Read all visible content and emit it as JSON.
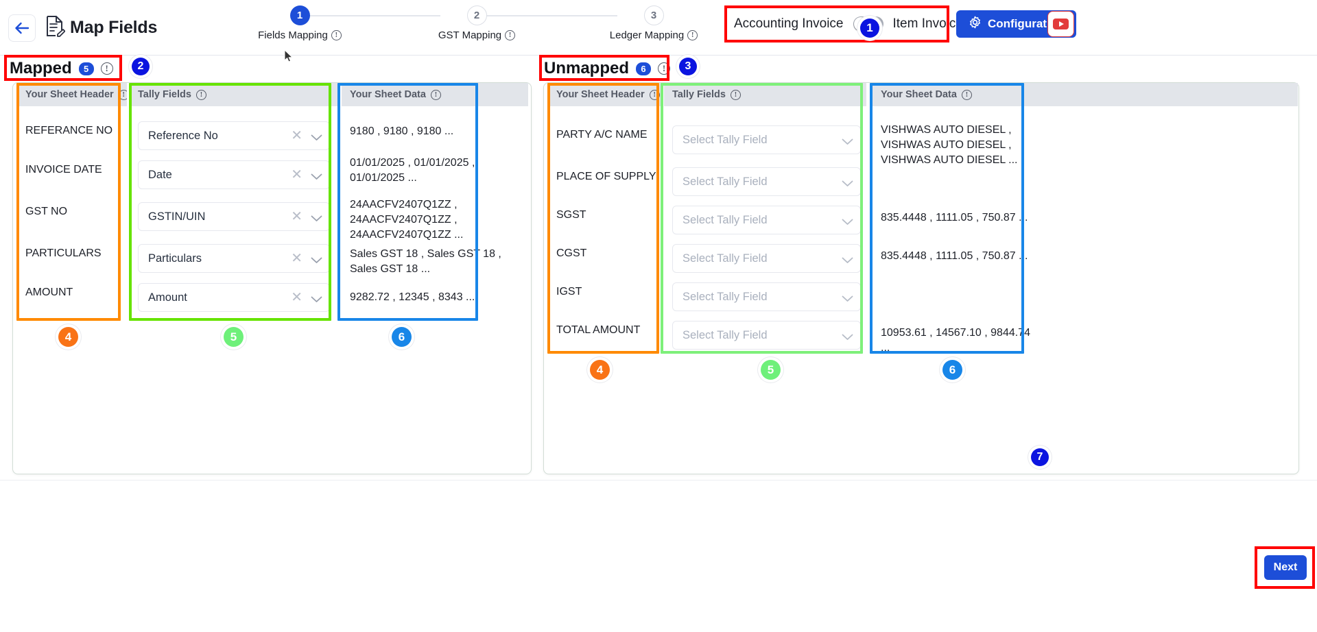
{
  "header": {
    "back_icon": "arrow-left-icon",
    "doc_icon": "document-edit-icon",
    "title": "Map Fields",
    "steps": [
      {
        "number": "1",
        "label": "Fields Mapping",
        "state": "active"
      },
      {
        "number": "2",
        "label": "GST Mapping",
        "state": "idle"
      },
      {
        "number": "3",
        "label": "Ledger Mapping",
        "state": "idle"
      }
    ],
    "toggle": {
      "left_label": "Accounting Invoice",
      "right_label": "Item Invoice",
      "state": "left"
    },
    "configuration_button": "Configuration",
    "gear_icon": "gear-icon",
    "youtube_icon": "youtube-icon",
    "marker_1": "1"
  },
  "mapped": {
    "title": "Mapped",
    "count": "5",
    "marker": "2",
    "columns": {
      "sheet_header": {
        "label": "Your Sheet Header",
        "marker": "4"
      },
      "tally_fields": {
        "label": "Tally Fields",
        "marker": "5"
      },
      "sheet_data": {
        "label": "Your Sheet Data",
        "marker": "6"
      }
    },
    "rows": [
      {
        "sheet_header": "REFERANCE NO",
        "tally_field": "Reference No",
        "sheet_data": "9180 , 9180 , 9180 ..."
      },
      {
        "sheet_header": "INVOICE DATE",
        "tally_field": "Date",
        "sheet_data": "01/01/2025 , 01/01/2025 , 01/01/2025 ..."
      },
      {
        "sheet_header": "GST NO",
        "tally_field": "GSTIN/UIN",
        "sheet_data": "24AACFV2407Q1ZZ , 24AACFV2407Q1ZZ , 24AACFV2407Q1ZZ ..."
      },
      {
        "sheet_header": "PARTICULARS",
        "tally_field": "Particulars",
        "sheet_data": "Sales GST 18 , Sales GST 18 , Sales GST 18 ..."
      },
      {
        "sheet_header": "AMOUNT",
        "tally_field": "Amount",
        "sheet_data": "9282.72 , 12345 , 8343 ..."
      }
    ]
  },
  "unmapped": {
    "title": "Unmapped",
    "count": "6",
    "marker": "3",
    "panel_marker": "7",
    "columns": {
      "sheet_header": {
        "label": "Your Sheet Header",
        "marker": "4"
      },
      "tally_fields": {
        "label": "Tally Fields",
        "marker": "5"
      },
      "sheet_data": {
        "label": "Your Sheet Data",
        "marker": "6"
      }
    },
    "select_placeholder": "Select Tally Field",
    "rows": [
      {
        "sheet_header": "PARTY A/C NAME",
        "tally_field": "",
        "sheet_data": "VISHWAS AUTO DIESEL , VISHWAS AUTO DIESEL , VISHWAS AUTO DIESEL ..."
      },
      {
        "sheet_header": "PLACE OF SUPPLY",
        "tally_field": "",
        "sheet_data": ""
      },
      {
        "sheet_header": "SGST",
        "tally_field": "",
        "sheet_data": "835.4448 , 1111.05 , 750.87 ..."
      },
      {
        "sheet_header": "CGST",
        "tally_field": "",
        "sheet_data": "835.4448 , 1111.05 , 750.87 ..."
      },
      {
        "sheet_header": "IGST",
        "tally_field": "",
        "sheet_data": ""
      },
      {
        "sheet_header": "TOTAL AMOUNT",
        "tally_field": "",
        "sheet_data": "10953.61 , 14567.10 , 9844.74 ..."
      }
    ]
  },
  "footer": {
    "next_button": "Next"
  },
  "colors": {
    "accent_blue": "#1d4ed8",
    "marker_blue": "#0b14e0",
    "orange": "#f97316",
    "green": "#6ef07a",
    "data_blue": "#1886e8",
    "highlight_red": "#ff0000",
    "outline_orange": "#ff8a00",
    "outline_green": "#66e300",
    "outline_blue": "#1886e8"
  }
}
